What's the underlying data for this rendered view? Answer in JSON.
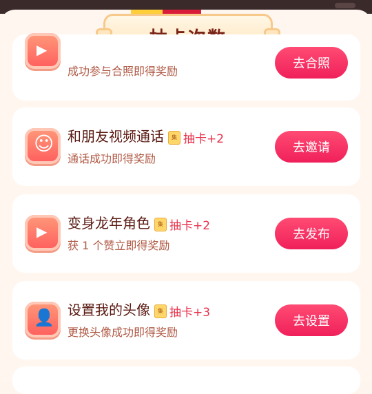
{
  "header": {
    "title": "抽卡次数"
  },
  "tasks": [
    {
      "title": "",
      "badge": "",
      "reward": "",
      "subtitle": "成功参与合照即得奖励",
      "button": "去合照"
    },
    {
      "title": "和朋友视频通话",
      "badge": "集",
      "reward": "抽卡+2",
      "subtitle": "通话成功即得奖励",
      "button": "去邀请"
    },
    {
      "title": "变身龙年角色",
      "badge": "集",
      "reward": "抽卡+2",
      "subtitle": "获 1 个赞立即得奖励",
      "button": "去发布"
    },
    {
      "title": "设置我的头像",
      "badge": "集",
      "reward": "抽卡+3",
      "subtitle": "更换头像成功即得奖励",
      "button": "去设置"
    }
  ],
  "colors": {
    "accent": "#f0205a",
    "title": "#7a2418",
    "reward": "#e8304b"
  }
}
